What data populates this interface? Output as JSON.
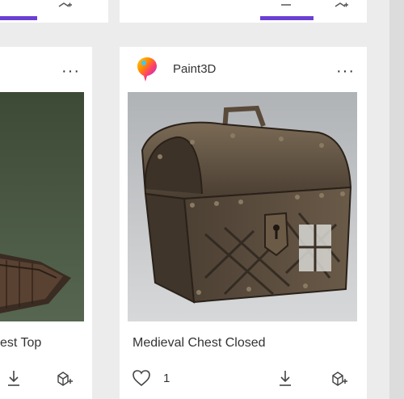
{
  "accent_color": "#6b3fd4",
  "cards": {
    "left_partial": {
      "title": "est Top",
      "more_label": "···",
      "icons": {
        "download": "download-icon",
        "view_3d": "view-in-3d-icon"
      }
    },
    "right": {
      "source": "Paint3D",
      "more_label": "···",
      "title": "Medieval Chest Closed",
      "likes": "1",
      "icons": {
        "logo": "paint3d-logo-icon",
        "like": "heart-icon",
        "download": "download-icon",
        "view_3d": "view-in-3d-icon"
      }
    }
  }
}
